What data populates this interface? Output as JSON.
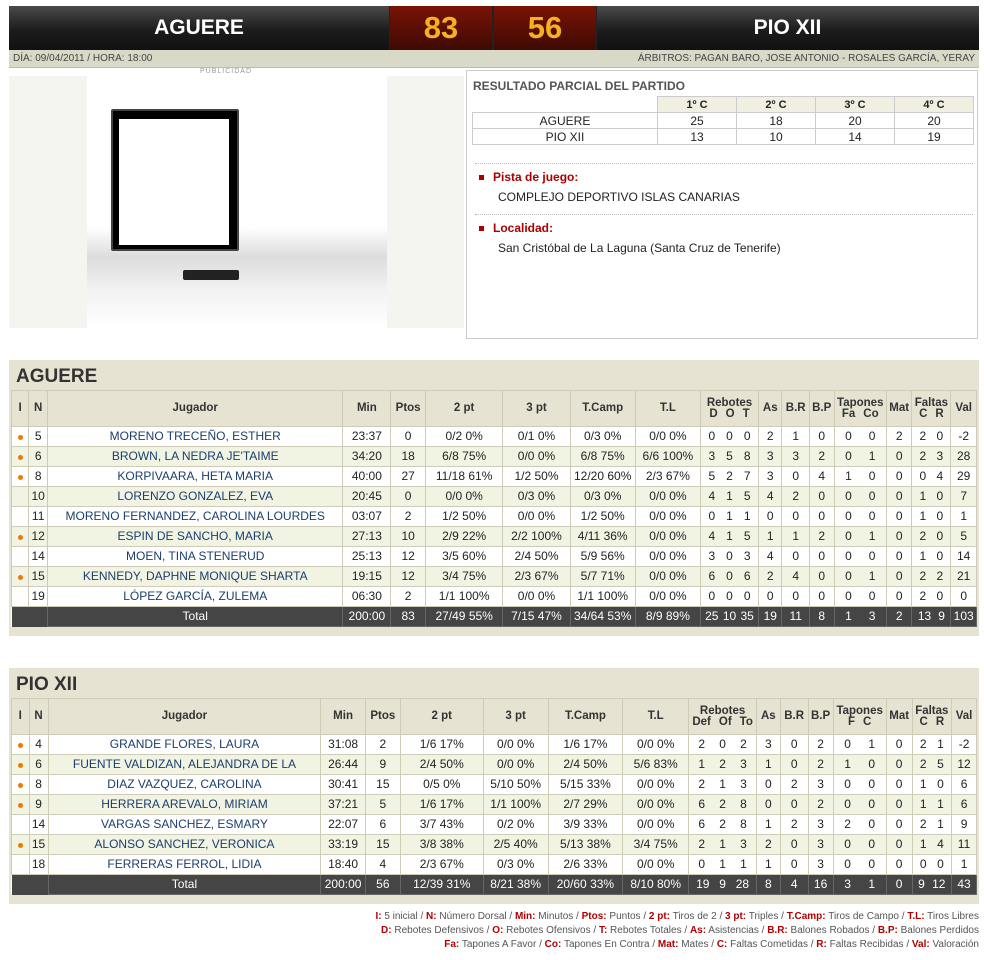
{
  "match": {
    "home_team": "AGUERE",
    "away_team": "PIO XII",
    "home_score": "83",
    "away_score": "56",
    "date_time": "DÍA: 09/04/2011 / HORA: 18:00",
    "referees": "ÁRBITROS: PAGAN BARO, JOSE ANTONIO - ROSALES GARCÍA, YERAY"
  },
  "ad": {
    "label": "PUBLICIDAD"
  },
  "partial": {
    "title": "RESULTADO PARCIAL DEL PARTIDO",
    "quarters": [
      "1º C",
      "2º C",
      "3º C",
      "4º C"
    ],
    "rows": [
      {
        "team": "AGUERE",
        "scores": [
          "25",
          "18",
          "20",
          "20"
        ]
      },
      {
        "team": "PIO XII",
        "scores": [
          "13",
          "10",
          "14",
          "19"
        ]
      }
    ]
  },
  "venue": {
    "court_label": "Pista de juego:",
    "court": "COMPLEJO DEPORTIVO ISLAS CANARIAS",
    "city_label": "Localidad:",
    "city": "San Cristóbal de La Laguna (Santa Cruz de Tenerife)"
  },
  "colors": {
    "score": "#f7b021",
    "score_bg": "#6a1004",
    "accent_red": "#a90000",
    "starter_dot": "#f07800",
    "section_bg": "#e6e3d2",
    "total_row": "#454545"
  },
  "aguere": {
    "title": "AGUERE",
    "headers": {
      "i": "I",
      "n": "N",
      "player": "Jugador",
      "min": "Min",
      "pts": "Ptos",
      "two": "2 pt",
      "three": "3 pt",
      "fg": "T.Camp",
      "ft": "T.L",
      "reb": "Rebotes",
      "reb_sub": [
        "D",
        "O",
        "T"
      ],
      "as": "As",
      "br": "B.R",
      "bp": "B.P",
      "blk": "Tapones",
      "blk_sub": [
        "Fa",
        "Co"
      ],
      "mat": "Mat",
      "fouls": "Faltas",
      "fouls_sub": [
        "C",
        "R"
      ],
      "val": "Val"
    },
    "players": [
      {
        "starter": true,
        "n": "5",
        "name": "MORENO TRECEÑO, ESTHER",
        "min": "23:37",
        "pts": "0",
        "two": "0/2 0%",
        "three": "0/1 0%",
        "fg": "0/3 0%",
        "ft": "0/0 0%",
        "d": "0",
        "o": "0",
        "t": "0",
        "as": "2",
        "br": "1",
        "bp": "0",
        "fa": "0",
        "co": "0",
        "mat": "2",
        "fc": "2",
        "fr": "0",
        "val": "-2"
      },
      {
        "starter": true,
        "n": "6",
        "name": "BROWN, LA NEDRA JE'TAIME",
        "min": "34:20",
        "pts": "18",
        "two": "6/8 75%",
        "three": "0/0 0%",
        "fg": "6/8 75%",
        "ft": "6/6 100%",
        "d": "3",
        "o": "5",
        "t": "8",
        "as": "3",
        "br": "3",
        "bp": "2",
        "fa": "0",
        "co": "1",
        "mat": "0",
        "fc": "2",
        "fr": "3",
        "val": "28"
      },
      {
        "starter": true,
        "n": "8",
        "name": "KORPIVAARA, HETA MARIA",
        "min": "40:00",
        "pts": "27",
        "two": "11/18 61%",
        "three": "1/2 50%",
        "fg": "12/20 60%",
        "ft": "2/3 67%",
        "d": "5",
        "o": "2",
        "t": "7",
        "as": "3",
        "br": "0",
        "bp": "4",
        "fa": "1",
        "co": "0",
        "mat": "0",
        "fc": "0",
        "fr": "4",
        "val": "29"
      },
      {
        "starter": false,
        "n": "10",
        "name": "LORENZO GONZALEZ, EVA",
        "min": "20:45",
        "pts": "0",
        "two": "0/0 0%",
        "three": "0/3 0%",
        "fg": "0/3 0%",
        "ft": "0/0 0%",
        "d": "4",
        "o": "1",
        "t": "5",
        "as": "4",
        "br": "2",
        "bp": "0",
        "fa": "0",
        "co": "0",
        "mat": "0",
        "fc": "1",
        "fr": "0",
        "val": "7"
      },
      {
        "starter": false,
        "n": "11",
        "name": "MORENO FERNANDEZ, CAROLINA LOURDES",
        "min": "03:07",
        "pts": "2",
        "two": "1/2 50%",
        "three": "0/0 0%",
        "fg": "1/2 50%",
        "ft": "0/0 0%",
        "d": "0",
        "o": "1",
        "t": "1",
        "as": "0",
        "br": "0",
        "bp": "0",
        "fa": "0",
        "co": "0",
        "mat": "0",
        "fc": "1",
        "fr": "0",
        "val": "1"
      },
      {
        "starter": true,
        "n": "12",
        "name": "ESPIN DE SANCHO, MARIA",
        "min": "27:13",
        "pts": "10",
        "two": "2/9 22%",
        "three": "2/2 100%",
        "fg": "4/11 36%",
        "ft": "0/0 0%",
        "d": "4",
        "o": "1",
        "t": "5",
        "as": "1",
        "br": "1",
        "bp": "2",
        "fa": "0",
        "co": "1",
        "mat": "0",
        "fc": "2",
        "fr": "0",
        "val": "5"
      },
      {
        "starter": false,
        "n": "14",
        "name": "MOEN, TINA STENERUD",
        "min": "25:13",
        "pts": "12",
        "two": "3/5 60%",
        "three": "2/4 50%",
        "fg": "5/9 56%",
        "ft": "0/0 0%",
        "d": "3",
        "o": "0",
        "t": "3",
        "as": "4",
        "br": "0",
        "bp": "0",
        "fa": "0",
        "co": "0",
        "mat": "0",
        "fc": "1",
        "fr": "0",
        "val": "14"
      },
      {
        "starter": true,
        "n": "15",
        "name": "KENNEDY, DAPHNE MONIQUE SHARTA",
        "min": "19:15",
        "pts": "12",
        "two": "3/4 75%",
        "three": "2/3 67%",
        "fg": "5/7 71%",
        "ft": "0/0 0%",
        "d": "6",
        "o": "0",
        "t": "6",
        "as": "2",
        "br": "4",
        "bp": "0",
        "fa": "0",
        "co": "1",
        "mat": "0",
        "fc": "2",
        "fr": "2",
        "val": "21"
      },
      {
        "starter": false,
        "n": "19",
        "name": "LÓPEZ GARCÍA, ZULEMA",
        "min": "06:30",
        "pts": "2",
        "two": "1/1 100%",
        "three": "0/0 0%",
        "fg": "1/1 100%",
        "ft": "0/0 0%",
        "d": "0",
        "o": "0",
        "t": "0",
        "as": "0",
        "br": "0",
        "bp": "0",
        "fa": "0",
        "co": "0",
        "mat": "0",
        "fc": "2",
        "fr": "0",
        "val": "0"
      }
    ],
    "total": {
      "label": "Total",
      "min": "200:00",
      "pts": "83",
      "two": "27/49 55%",
      "three": "7/15 47%",
      "fg": "34/64 53%",
      "ft": "8/9 89%",
      "d": "25",
      "o": "10",
      "t": "35",
      "as": "19",
      "br": "11",
      "bp": "8",
      "fa": "1",
      "co": "3",
      "mat": "2",
      "fc": "13",
      "fr": "9",
      "val": "103"
    }
  },
  "pio": {
    "title": "PIO XII",
    "headers": {
      "i": "I",
      "n": "N",
      "player": "Jugador",
      "min": "Min",
      "pts": "Ptos",
      "two": "2 pt",
      "three": "3 pt",
      "fg": "T.Camp",
      "ft": "T.L",
      "reb": "Rebotes",
      "reb_sub": [
        "Def",
        "Of",
        "To"
      ],
      "as": "As",
      "br": "B.R",
      "bp": "B.P",
      "blk": "Tapones",
      "blk_sub": [
        "F",
        "C"
      ],
      "mat": "Mat",
      "fouls": "Faltas",
      "fouls_sub": [
        "C",
        "R"
      ],
      "val": "Val"
    },
    "players": [
      {
        "starter": true,
        "n": "4",
        "name": "GRANDE FLORES, LAURA",
        "min": "31:08",
        "pts": "2",
        "two": "1/6 17%",
        "three": "0/0 0%",
        "fg": "1/6 17%",
        "ft": "0/0 0%",
        "d": "2",
        "o": "0",
        "t": "2",
        "as": "3",
        "br": "0",
        "bp": "2",
        "fa": "0",
        "co": "1",
        "mat": "0",
        "fc": "2",
        "fr": "1",
        "val": "-2"
      },
      {
        "starter": true,
        "n": "6",
        "name": "FUENTE VALDIZAN, ALEJANDRA DE LA",
        "min": "26:44",
        "pts": "9",
        "two": "2/4 50%",
        "three": "0/0 0%",
        "fg": "2/4 50%",
        "ft": "5/6 83%",
        "d": "1",
        "o": "2",
        "t": "3",
        "as": "1",
        "br": "0",
        "bp": "2",
        "fa": "1",
        "co": "0",
        "mat": "0",
        "fc": "2",
        "fr": "5",
        "val": "12"
      },
      {
        "starter": true,
        "n": "8",
        "name": "DIAZ VAZQUEZ, CAROLINA",
        "min": "30:41",
        "pts": "15",
        "two": "0/5 0%",
        "three": "5/10 50%",
        "fg": "5/15 33%",
        "ft": "0/0 0%",
        "d": "2",
        "o": "1",
        "t": "3",
        "as": "0",
        "br": "2",
        "bp": "3",
        "fa": "0",
        "co": "0",
        "mat": "0",
        "fc": "1",
        "fr": "0",
        "val": "6"
      },
      {
        "starter": true,
        "n": "9",
        "name": "HERRERA AREVALO, MIRIAM",
        "min": "37:21",
        "pts": "5",
        "two": "1/6 17%",
        "three": "1/1 100%",
        "fg": "2/7 29%",
        "ft": "0/0 0%",
        "d": "6",
        "o": "2",
        "t": "8",
        "as": "0",
        "br": "0",
        "bp": "2",
        "fa": "0",
        "co": "0",
        "mat": "0",
        "fc": "1",
        "fr": "1",
        "val": "6"
      },
      {
        "starter": false,
        "n": "14",
        "name": "VARGAS SANCHEZ, ESMARY",
        "min": "22:07",
        "pts": "6",
        "two": "3/7 43%",
        "three": "0/2 0%",
        "fg": "3/9 33%",
        "ft": "0/0 0%",
        "d": "6",
        "o": "2",
        "t": "8",
        "as": "1",
        "br": "2",
        "bp": "3",
        "fa": "2",
        "co": "0",
        "mat": "0",
        "fc": "2",
        "fr": "1",
        "val": "9"
      },
      {
        "starter": true,
        "n": "15",
        "name": "ALONSO SANCHEZ, VERONICA",
        "min": "33:19",
        "pts": "15",
        "two": "3/8 38%",
        "three": "2/5 40%",
        "fg": "5/13 38%",
        "ft": "3/4 75%",
        "d": "2",
        "o": "1",
        "t": "3",
        "as": "2",
        "br": "0",
        "bp": "3",
        "fa": "0",
        "co": "0",
        "mat": "0",
        "fc": "1",
        "fr": "4",
        "val": "11"
      },
      {
        "starter": false,
        "n": "18",
        "name": "FERRERAS FERROL, LIDIA",
        "min": "18:40",
        "pts": "4",
        "two": "2/3 67%",
        "three": "0/3 0%",
        "fg": "2/6 33%",
        "ft": "0/0 0%",
        "d": "0",
        "o": "1",
        "t": "1",
        "as": "1",
        "br": "0",
        "bp": "3",
        "fa": "0",
        "co": "0",
        "mat": "0",
        "fc": "0",
        "fr": "0",
        "val": "1"
      }
    ],
    "total": {
      "label": "Total",
      "min": "200:00",
      "pts": "56",
      "two": "12/39 31%",
      "three": "8/21 38%",
      "fg": "20/60 33%",
      "ft": "8/10 80%",
      "d": "19",
      "o": "9",
      "t": "28",
      "as": "8",
      "br": "4",
      "bp": "16",
      "fa": "3",
      "co": "1",
      "mat": "0",
      "fc": "9",
      "fr": "12",
      "val": "43"
    }
  },
  "legend": {
    "lines": [
      [
        [
          "I:",
          " 5 inicial / "
        ],
        [
          "N:",
          " Número Dorsal / "
        ],
        [
          "Min:",
          " Minutos / "
        ],
        [
          "Ptos:",
          " Puntos / "
        ],
        [
          "2 pt:",
          " Tiros de 2 / "
        ],
        [
          "3 pt:",
          " Triples / "
        ],
        [
          "T.Camp:",
          " Tiros de Campo / "
        ],
        [
          "T.L:",
          " Tiros Libres"
        ]
      ],
      [
        [
          "D:",
          " Rebotes Defensivos / "
        ],
        [
          "O:",
          " Rebotes Ofensivos / "
        ],
        [
          "T:",
          " Rebotes Totales / "
        ],
        [
          "As:",
          " Asistencias / "
        ],
        [
          "B.R:",
          " Balones Robados / "
        ],
        [
          "B.P:",
          " Balones Perdidos"
        ]
      ],
      [
        [
          "Fa:",
          " Tapones A Favor / "
        ],
        [
          "Co:",
          " Tapones En Contra / "
        ],
        [
          "Mat:",
          " Mates / "
        ],
        [
          "C:",
          " Faltas Cometidas / "
        ],
        [
          "R:",
          " Faltas Recibidas / "
        ],
        [
          "Val:",
          " Valoración"
        ]
      ]
    ]
  }
}
